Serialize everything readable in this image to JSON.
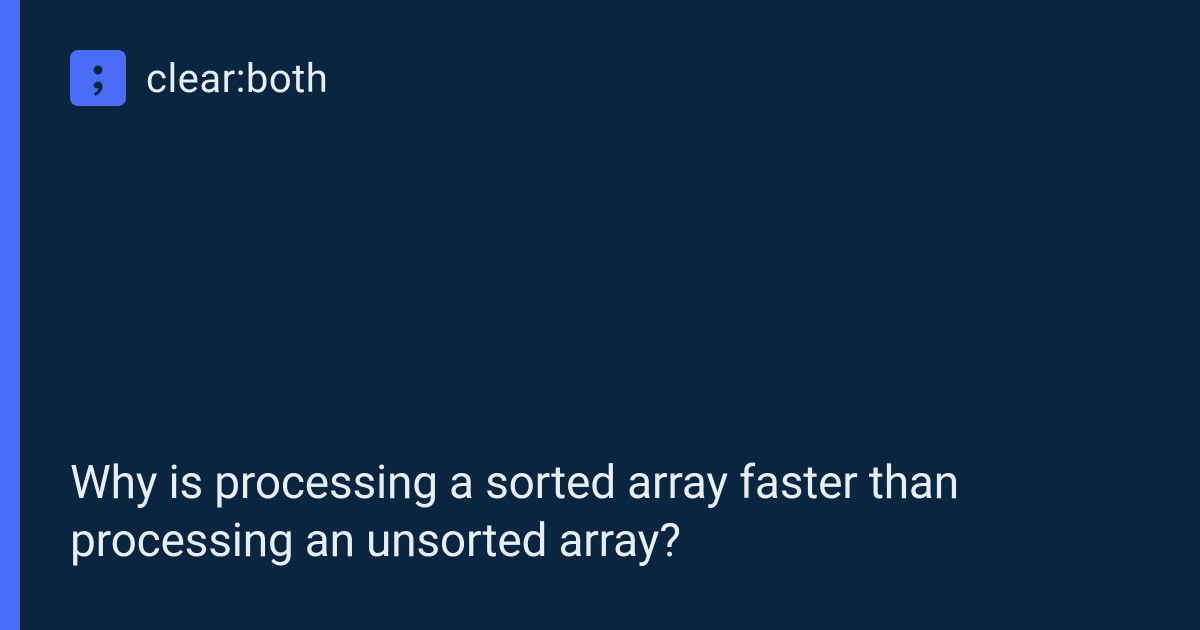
{
  "brand": {
    "name": "clear:both",
    "accent_color": "#4a6cf7",
    "bg_color": "#0a2540"
  },
  "headline": "Why is processing a sorted array faster than processing an unsorted array?"
}
